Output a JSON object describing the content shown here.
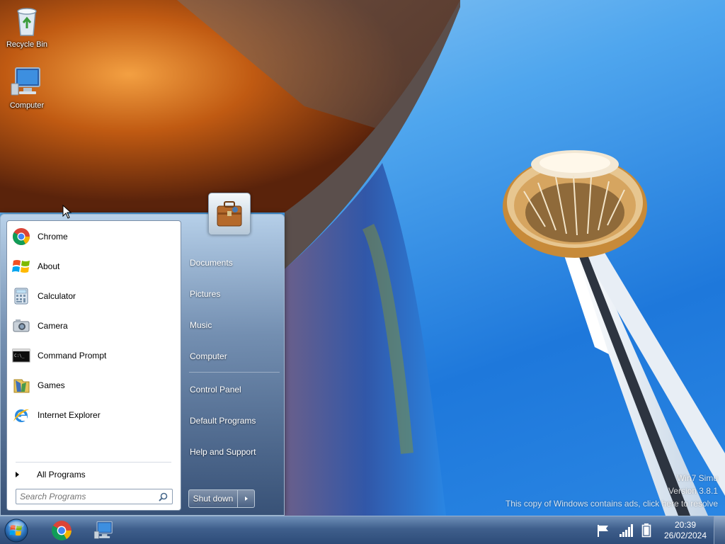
{
  "desktop": {
    "icons": [
      {
        "label": "Recycle Bin",
        "icon": "recycle-bin-icon"
      },
      {
        "label": "Computer",
        "icon": "computer-icon"
      }
    ]
  },
  "start_menu": {
    "programs": [
      {
        "label": "Chrome",
        "icon": "chrome-icon"
      },
      {
        "label": "About",
        "icon": "windows-logo-icon"
      },
      {
        "label": "Calculator",
        "icon": "calculator-icon"
      },
      {
        "label": "Camera",
        "icon": "camera-icon"
      },
      {
        "label": "Command Prompt",
        "icon": "command-prompt-icon"
      },
      {
        "label": "Games",
        "icon": "games-icon"
      },
      {
        "label": "Internet Explorer",
        "icon": "internet-explorer-icon"
      }
    ],
    "all_programs": "All Programs",
    "search_placeholder": "Search Programs",
    "right_links": {
      "documents": "Documents",
      "pictures": "Pictures",
      "music": "Music",
      "computer": "Computer",
      "control_panel": "Control Panel",
      "default_programs": "Default Programs",
      "help_support": "Help and Support"
    },
    "shutdown_label": "Shut down"
  },
  "watermark": {
    "line1": "Win7 Simu",
    "line2": "Version 3.8.1",
    "line3": "This copy of Windows contains ads, click here to resolve"
  },
  "taskbar": {
    "pinned": [
      "chrome-icon",
      "computer-icon"
    ],
    "tray": [
      "action-center-flag-icon",
      "network-signal-icon",
      "battery-icon"
    ],
    "clock": {
      "time": "20:39",
      "date": "26/02/2024"
    }
  },
  "colors": {
    "taskbar": "#3f5f8c",
    "start_menu_accent": "#7c8faa",
    "sky": "#2a86e3"
  }
}
